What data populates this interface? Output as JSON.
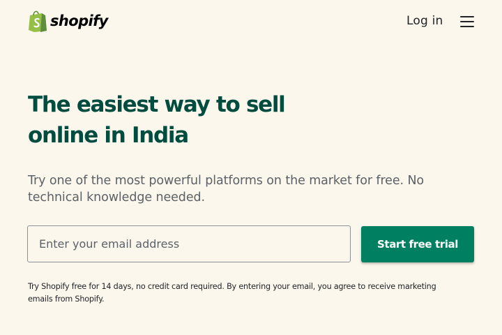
{
  "header": {
    "logo_text": "shopify",
    "login_label": "Log in",
    "menu_icon": "hamburger-menu-icon"
  },
  "hero": {
    "title_line1": "The easiest way to sell",
    "title_line2": "online in India",
    "subtitle": "Try one of the most powerful platforms on the market for free. No technical knowledge needed."
  },
  "signup": {
    "email_value": "",
    "email_placeholder": "Enter your email address",
    "button_label": "Start free trial",
    "disclaimer": "Try Shopify free for 14 days, no credit card required. By entering your email, you agree to receive marketing emails from Shopify."
  },
  "colors": {
    "background": "#fbf7ed",
    "brand_green": "#008060",
    "title_green": "#004c3f",
    "logo_bag": "#95bf47"
  }
}
